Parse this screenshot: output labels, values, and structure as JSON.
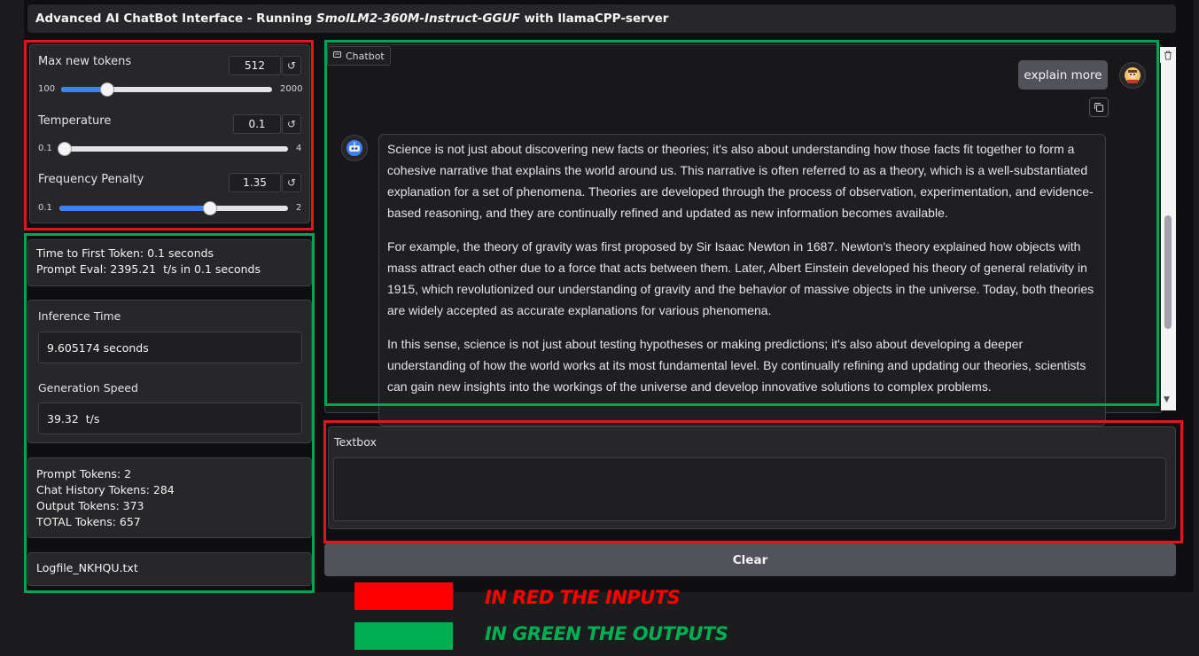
{
  "header": {
    "title_prefix": "Advanced AI ChatBot Interface - Running ",
    "title_model": "SmolLM2-360M-Instruct-GGUF",
    "title_suffix": " with llamaCPP-server"
  },
  "settings": {
    "max_tokens": {
      "label": "Max new tokens",
      "value": "512",
      "min": "100",
      "max": "2000",
      "fraction": 0.217
    },
    "temperature": {
      "label": "Temperature",
      "value": "0.1",
      "min": "0.1",
      "max": "4",
      "fraction": 0.0
    },
    "frequency_penalty": {
      "label": "Frequency Penalty",
      "value": "1.35",
      "min": "0.1",
      "max": "2",
      "fraction": 0.658
    },
    "reset_glyph": "↺"
  },
  "stats": {
    "time_to_first": "Time to First Token: 0.1 seconds",
    "prompt_eval": "Prompt Eval: 2395.21  t/s in 0.1 seconds",
    "inference_time_label": "Inference Time",
    "inference_time_value": "9.605174 seconds",
    "generation_speed_label": "Generation Speed",
    "generation_speed_value": "39.32  t/s",
    "prompt_tokens": "Prompt Tokens: 2",
    "chat_history_tokens": "Chat History Tokens: 284",
    "output_tokens": "Output Tokens: 373",
    "total_tokens": "TOTAL Tokens: 657",
    "logfile": "Logfile_NKHQU.txt"
  },
  "chat": {
    "label": "Chatbot",
    "user_message": "explain more",
    "bot_paragraphs": [
      "Science is not just about discovering new facts or theories; it's also about understanding how those facts fit together to form a cohesive narrative that explains the world around us. This narrative is often referred to as a theory, which is a well-substantiated explanation for a set of phenomena. Theories are developed through the process of observation, experimentation, and evidence-based reasoning, and they are continually refined and updated as new information becomes available.",
      "For example, the theory of gravity was first proposed by Sir Isaac Newton in 1687. Newton's theory explained how objects with mass attract each other due to a force that acts between them. Later, Albert Einstein developed his theory of general relativity in 1915, which revolutionized our understanding of gravity and the behavior of massive objects in the universe. Today, both theories are widely accepted as accurate explanations for various phenomena.",
      "In this sense, science is not just about testing hypotheses or making predictions; it's also about developing a deeper understanding of how the world works at its most fundamental level. By continually refining and updating our theories, scientists can gain new insights into the workings of the universe and develop innovative solutions to complex problems."
    ]
  },
  "input": {
    "label": "Textbox",
    "value": "",
    "clear_label": "Clear"
  },
  "legend": {
    "inputs_text": "IN RED THE INPUTS",
    "outputs_text": "IN GREEN THE OUTPUTS",
    "inputs_color": "#ff0000",
    "outputs_color": "#00b050"
  }
}
